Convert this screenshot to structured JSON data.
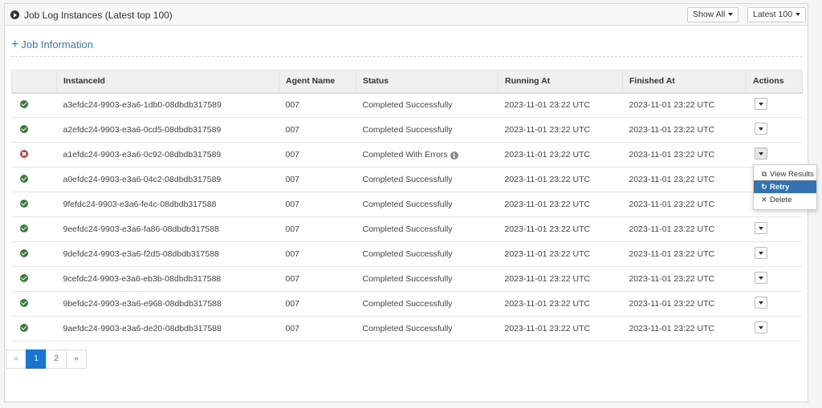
{
  "header": {
    "title": "Job Log Instances (Latest top 100)",
    "show_all_label": "Show All",
    "latest_label": "Latest 100"
  },
  "job_info": {
    "label": "Job Information",
    "plus": "+"
  },
  "table": {
    "columns": [
      "",
      "InstanceId",
      "Agent Name",
      "Status",
      "Running At",
      "Finished At",
      "Actions"
    ],
    "rows": [
      {
        "status_type": "ok",
        "instance_id": "a3efdc24-9903-e3a6-1db0-08dbdb317589",
        "agent": "007",
        "status": "Completed Successfully",
        "running_at": "2023-11-01 23:22 UTC",
        "finished_at": "2023-11-01 23:22 UTC"
      },
      {
        "status_type": "ok",
        "instance_id": "a2efdc24-9903-e3a6-0cd5-08dbdb317589",
        "agent": "007",
        "status": "Completed Successfully",
        "running_at": "2023-11-01 23:22 UTC",
        "finished_at": "2023-11-01 23:22 UTC"
      },
      {
        "status_type": "error",
        "instance_id": "a1efdc24-9903-e3a6-0c92-08dbdb317589",
        "agent": "007",
        "status": "Completed With Errors",
        "running_at": "2023-11-01 23:22 UTC",
        "finished_at": "2023-11-01 23:22 UTC"
      },
      {
        "status_type": "ok",
        "instance_id": "a0efdc24-9903-e3a6-04c2-08dbdb317589",
        "agent": "007",
        "status": "Completed Successfully",
        "running_at": "2023-11-01 23:22 UTC",
        "finished_at": "2023-11-01 23:22 UTC"
      },
      {
        "status_type": "ok",
        "instance_id": "9fefdc24-9903-e3a6-fe4c-08dbdb317588",
        "agent": "007",
        "status": "Completed Successfully",
        "running_at": "2023-11-01 23:22 UTC",
        "finished_at": "2023-11-01 23:22 UTC"
      },
      {
        "status_type": "ok",
        "instance_id": "9eefdc24-9903-e3a6-fa86-08dbdb317588",
        "agent": "007",
        "status": "Completed Successfully",
        "running_at": "2023-11-01 23:22 UTC",
        "finished_at": "2023-11-01 23:22 UTC"
      },
      {
        "status_type": "ok",
        "instance_id": "9defdc24-9903-e3a6-f2d5-08dbdb317588",
        "agent": "007",
        "status": "Completed Successfully",
        "running_at": "2023-11-01 23:22 UTC",
        "finished_at": "2023-11-01 23:22 UTC"
      },
      {
        "status_type": "ok",
        "instance_id": "9cefdc24-9903-e3a6-eb3b-08dbdb317588",
        "agent": "007",
        "status": "Completed Successfully",
        "running_at": "2023-11-01 23:22 UTC",
        "finished_at": "2023-11-01 23:22 UTC"
      },
      {
        "status_type": "ok",
        "instance_id": "9befdc24-9903-e3a6-e968-08dbdb317588",
        "agent": "007",
        "status": "Completed Successfully",
        "running_at": "2023-11-01 23:22 UTC",
        "finished_at": "2023-11-01 23:22 UTC"
      },
      {
        "status_type": "ok",
        "instance_id": "9aefdc24-9903-e3a6-de20-08dbdb317588",
        "agent": "007",
        "status": "Completed Successfully",
        "running_at": "2023-11-01 23:22 UTC",
        "finished_at": "2023-11-01 23:22 UTC"
      }
    ]
  },
  "action_menu": {
    "items": [
      {
        "label": "View Results",
        "icon": "external-link-icon",
        "glyph": "⧉"
      },
      {
        "label": "Retry",
        "icon": "retry-icon",
        "glyph": "↻"
      },
      {
        "label": "Delete",
        "icon": "close-icon",
        "glyph": "✕"
      }
    ],
    "highlighted_index": 1
  },
  "pagination": {
    "prev": "«",
    "pages": [
      "1",
      "2"
    ],
    "active_page": "1",
    "next": "»"
  },
  "colors": {
    "link_blue": "#3c7ab7",
    "success_green": "#3c7a3c",
    "error_red": "#b93c3c",
    "menu_highlight": "#3472b0",
    "active_page": "#1a74d0"
  }
}
